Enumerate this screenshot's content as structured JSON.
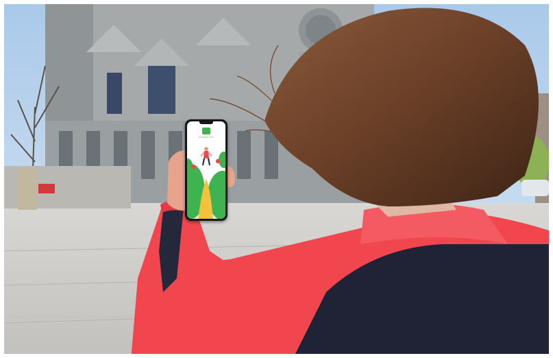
{
  "app": {
    "title": "ACCESS CITY",
    "icon": "app-logo-icon"
  },
  "colors": {
    "jacket": "#f2464f",
    "jacket_dark": "#1f2335",
    "app_green": "#3fb34f",
    "app_path": "#f3c23c"
  }
}
